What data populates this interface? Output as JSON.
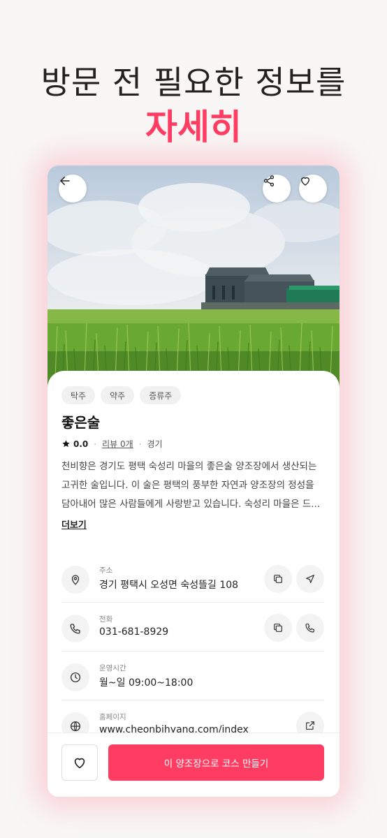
{
  "headline": {
    "line1": "방문 전 필요한 정보를",
    "line2": "자세히"
  },
  "colors": {
    "accent": "#ff3d63",
    "text_primary": "#222222",
    "text_secondary": "#888888"
  },
  "hero": {
    "back_icon": "arrow-left-icon",
    "share_icon": "share-icon",
    "like_icon": "heart-icon"
  },
  "place": {
    "tags": [
      "탁주",
      "약주",
      "증류주"
    ],
    "name": "좋은술",
    "rating": "0.0",
    "review_link": "리뷰 0개",
    "region": "경기",
    "description_lines": [
      "천비향은 경기도 평택 숙성리 마을의 좋은술 양조장에서 생산되는",
      "고귀한 술입니다. 이 술은 평택의 풍부한 자연과 양조장의 정성을",
      "담아내어 많은 사람들에게 사랑받고 있습니다. 숙성리 마을은 드..."
    ],
    "more_label": "더보기"
  },
  "info": {
    "address": {
      "label": "주소",
      "value": "경기 평택시 오성면 숙성뜰길 108"
    },
    "phone": {
      "label": "전화",
      "value": "031-681-8929"
    },
    "hours": {
      "label": "운영시간",
      "value": "월~일 09:00~18:00"
    },
    "homepage": {
      "label": "홈페이지",
      "value": "www.cheonbihyang.com/index"
    }
  },
  "bottom": {
    "cta_label": "이 양조장으로 코스 만들기"
  }
}
